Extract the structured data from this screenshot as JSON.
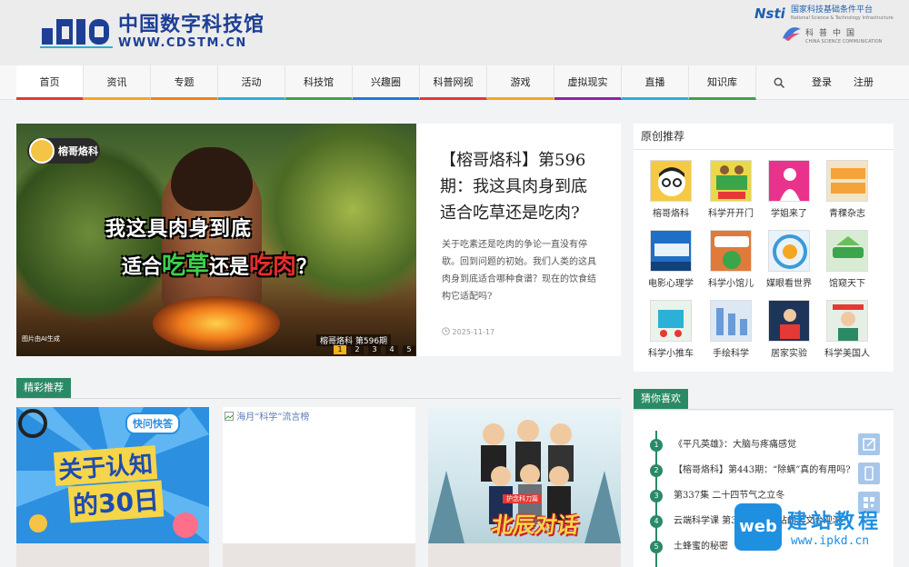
{
  "brand": {
    "cn": "中国数字科技馆",
    "en": "WWW.CDSTM.CN",
    "partner1_mark": "Nsti",
    "partner1_cn": "国家科技基础条件平台",
    "partner1_en": "National Science & Technology Infrastructure",
    "partner2_cn": "科普中国",
    "partner2_en": "CHINA SCIENCE COMMUNICATION"
  },
  "nav": {
    "items": [
      {
        "label": "首页",
        "color": "#e53935"
      },
      {
        "label": "资讯",
        "color": "#f5a623"
      },
      {
        "label": "专题",
        "color": "#f57f17"
      },
      {
        "label": "活动",
        "color": "#2bb0d8"
      },
      {
        "label": "科技馆",
        "color": "#3aa54a"
      },
      {
        "label": "兴趣圈",
        "color": "#1f7ad8"
      },
      {
        "label": "科普网视",
        "color": "#e53935"
      },
      {
        "label": "游戏",
        "color": "#f5a623"
      },
      {
        "label": "虚拟现实",
        "color": "#8e24aa"
      },
      {
        "label": "直播",
        "color": "#2bb0d8"
      },
      {
        "label": "知识库",
        "color": "#3aa54a"
      }
    ],
    "login": "登录",
    "register": "注册",
    "search_icon": "search-icon"
  },
  "featured": {
    "hero_badge": "榕哥烙科",
    "hero_line1": "我这具肉身到底",
    "hero_line2_a": "适合",
    "hero_line2_b": "吃草",
    "hero_line2_c": "还是",
    "hero_line2_d": "吃肉",
    "hero_line2_e": "？",
    "hero_credit": "图片由AI生成",
    "hero_episode": "榕哥烙科 第596期",
    "dots": [
      "1",
      "2",
      "3",
      "4",
      "5"
    ],
    "title": "【榕哥烙科】第596期：我这具肉身到底适合吃草还是吃肉?",
    "desc": "关于吃素还是吃肉的争论一直没有停歇。回到问题的初始。我们人类的这具肉身到底适合哪种食谱？现在的饮食结构它适配吗?",
    "date": "2025-11-17"
  },
  "original": {
    "title": "原创推荐",
    "items": [
      {
        "label": "榕哥烙科",
        "bg": "#f6c944"
      },
      {
        "label": "科学开开门",
        "bg": "#e8d84a"
      },
      {
        "label": "学姐来了",
        "bg": "#e9328c"
      },
      {
        "label": "青稞杂志",
        "bg": "#f3e4c6"
      },
      {
        "label": "电影心理学",
        "bg": "#1f6fc4"
      },
      {
        "label": "科学小馆儿",
        "bg": "#e07a3a"
      },
      {
        "label": "媒眼看世界",
        "bg": "#e8f2fb"
      },
      {
        "label": "馆窥天下",
        "bg": "#d8ecd4"
      },
      {
        "label": "科学小推车",
        "bg": "#e9f3ea"
      },
      {
        "label": "手绘科学",
        "bg": "#dce8f4"
      },
      {
        "label": "居家实验",
        "bg": "#1d3558"
      },
      {
        "label": "科学美国人",
        "bg": "#e6efe6"
      }
    ]
  },
  "picks": {
    "title": "精彩推荐",
    "card1_bubble": "快问快答",
    "card1_line1": "关于认知",
    "card1_line2": "的30日",
    "card2_alt": "海月“科学”流言榜",
    "card3_banner": "护念科刀篇",
    "card3_title": "北辰对话"
  },
  "guess": {
    "title": "猜你喜欢",
    "items": [
      {
        "num": "1",
        "text": "《平凡英雄》：大脑与疼痛感觉"
      },
      {
        "num": "2",
        "text": "【榕哥烙科】第443期：“除螨”真的有用吗?"
      },
      {
        "num": "3",
        "text": "第337集 二十四节气之立冬"
      },
      {
        "num": "4",
        "text": "云端科学课 第3?期：科学站的天文台观测"
      },
      {
        "num": "5",
        "text": "土蜂蜜的秘密"
      }
    ]
  },
  "watermark": {
    "badge": "web",
    "title": "建站教程",
    "url": "www.ipkd.cn"
  }
}
